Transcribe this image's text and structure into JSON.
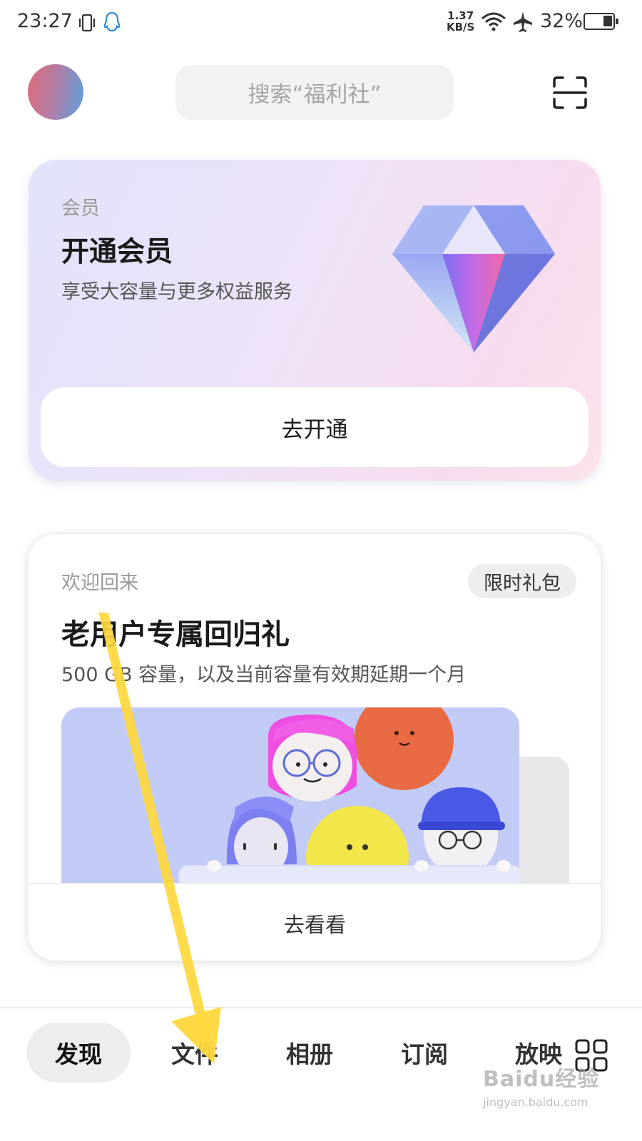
{
  "status_bar": {
    "time": "23:27",
    "net_speed_value": "1.37",
    "net_speed_unit": "KB/S",
    "battery": "32%",
    "icons": [
      "vibrate-icon",
      "qq-icon",
      "wifi-icon",
      "airplane-icon",
      "battery-icon"
    ]
  },
  "header": {
    "search_placeholder": "搜索“福利社”",
    "icons": [
      "avatar",
      "scan-icon"
    ]
  },
  "member_card": {
    "kicker": "会员",
    "title": "开通会员",
    "subtitle": "享受大容量与更多权益服务",
    "button": "去开通",
    "icon": "diamond-icon"
  },
  "welcome_card": {
    "kicker": "欢迎回来",
    "badge": "限时礼包",
    "title": "老用户专属回归礼",
    "subtitle": "500 GB 容量，以及当前容量有效期延期一个月",
    "button": "去看看"
  },
  "bottom_nav": {
    "items": [
      {
        "label": "发现",
        "active": true
      },
      {
        "label": "文件",
        "active": false
      },
      {
        "label": "相册",
        "active": false
      },
      {
        "label": "订阅",
        "active": false
      },
      {
        "label": "放映",
        "active": false
      }
    ],
    "more_icon": "grid-icon"
  },
  "watermark": {
    "brand": "Baidu经验",
    "url": "jingyan.baidu.com"
  },
  "colors": {
    "annotation_arrow": "#ffd83c",
    "card_gradient_start": "#e1e3fb",
    "card_gradient_end": "#fbe3ec",
    "banner_bg": "#c2cbf6"
  }
}
